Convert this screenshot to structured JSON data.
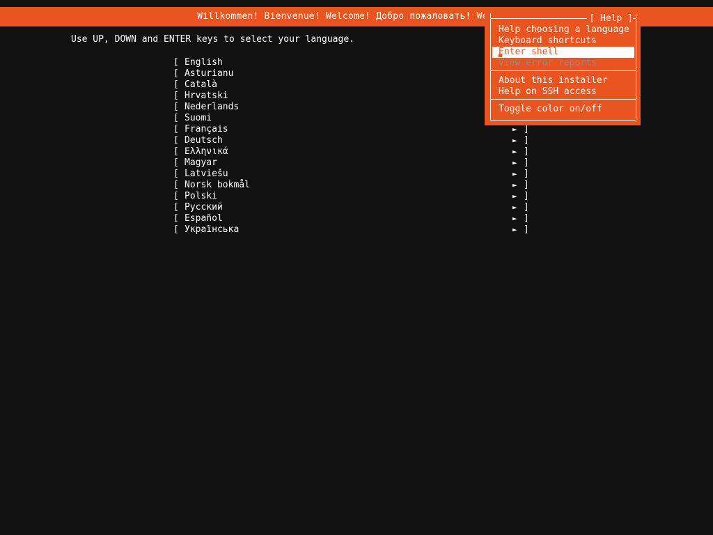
{
  "screen": {
    "background_color": "#111111",
    "accent_color": "#e95420",
    "text_color": "#ffffff",
    "disabled_color": "#8b8b9b"
  },
  "header": {
    "welcome_text": "Willkommen! Bienvenue! Welcome! Добро пожаловать! Welkom!"
  },
  "instruction": {
    "text": "Use UP, DOWN and ENTER keys to select your language."
  },
  "language_list": {
    "bracket_open": "[",
    "bracket_close": "]",
    "arrow_icon": "►",
    "items": [
      {
        "label": "English"
      },
      {
        "label": "Asturianu"
      },
      {
        "label": "Català"
      },
      {
        "label": "Hrvatski"
      },
      {
        "label": "Nederlands"
      },
      {
        "label": "Suomi"
      },
      {
        "label": "Français"
      },
      {
        "label": "Deutsch"
      },
      {
        "label": "Ελληνικά"
      },
      {
        "label": "Magyar"
      },
      {
        "label": "Latviešu"
      },
      {
        "label": "Norsk bokmål"
      },
      {
        "label": "Polski"
      },
      {
        "label": "Русский"
      },
      {
        "label": "Español"
      },
      {
        "label": "Українська"
      }
    ]
  },
  "help_menu": {
    "title": "[ Help ]",
    "sections": [
      {
        "items": [
          {
            "label": "Help choosing a language",
            "state": "normal"
          },
          {
            "label": "Keyboard shortcuts",
            "state": "normal"
          },
          {
            "label": "Enter shell",
            "state": "selected"
          },
          {
            "label": "View error reports",
            "state": "disabled"
          }
        ]
      },
      {
        "items": [
          {
            "label": "About this installer",
            "state": "normal"
          },
          {
            "label": "Help on SSH access",
            "state": "normal"
          }
        ]
      },
      {
        "items": [
          {
            "label": "Toggle color on/off",
            "state": "normal"
          }
        ]
      }
    ]
  }
}
